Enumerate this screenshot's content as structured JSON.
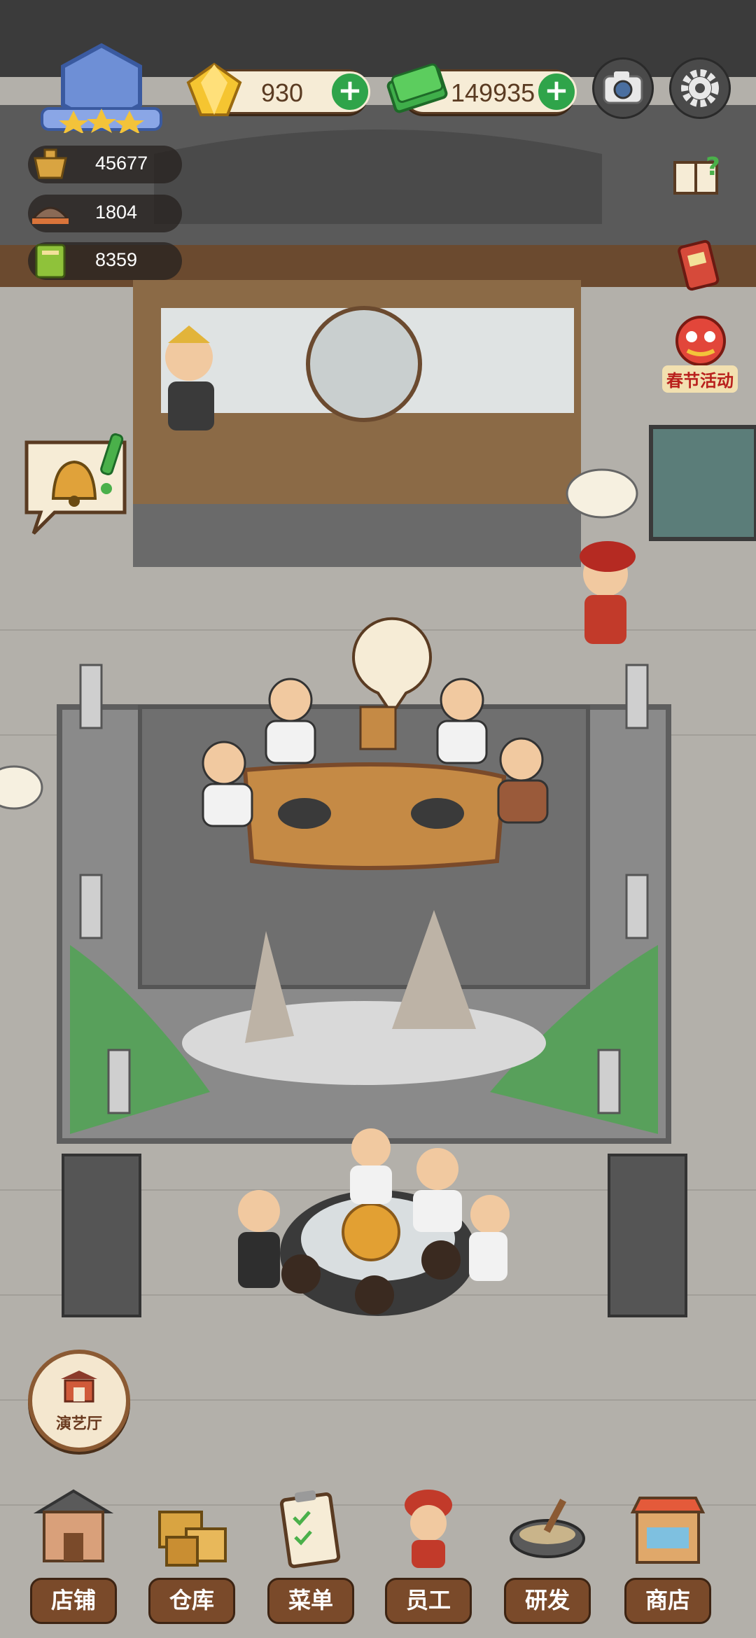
{
  "currency": {
    "gems": "930",
    "cash": "149935"
  },
  "stats": [
    {
      "icon": "pot-icon",
      "value": "45677"
    },
    {
      "icon": "food-tray-icon",
      "value": "1804"
    },
    {
      "icon": "recipe-book-icon",
      "value": "8359"
    }
  ],
  "event": {
    "label": "春节活动"
  },
  "theater": {
    "label": "演艺厅"
  },
  "bottom_nav": [
    {
      "label": "店铺",
      "icon": "shop-building-icon"
    },
    {
      "label": "仓库",
      "icon": "warehouse-boxes-icon"
    },
    {
      "label": "菜单",
      "icon": "menu-clipboard-icon"
    },
    {
      "label": "员工",
      "icon": "staff-chef-icon"
    },
    {
      "label": "研发",
      "icon": "research-wok-icon"
    },
    {
      "label": "商店",
      "icon": "store-stall-icon"
    }
  ],
  "colors": {
    "accent_green": "#2fa44a",
    "wood": "#7a4a2a"
  }
}
